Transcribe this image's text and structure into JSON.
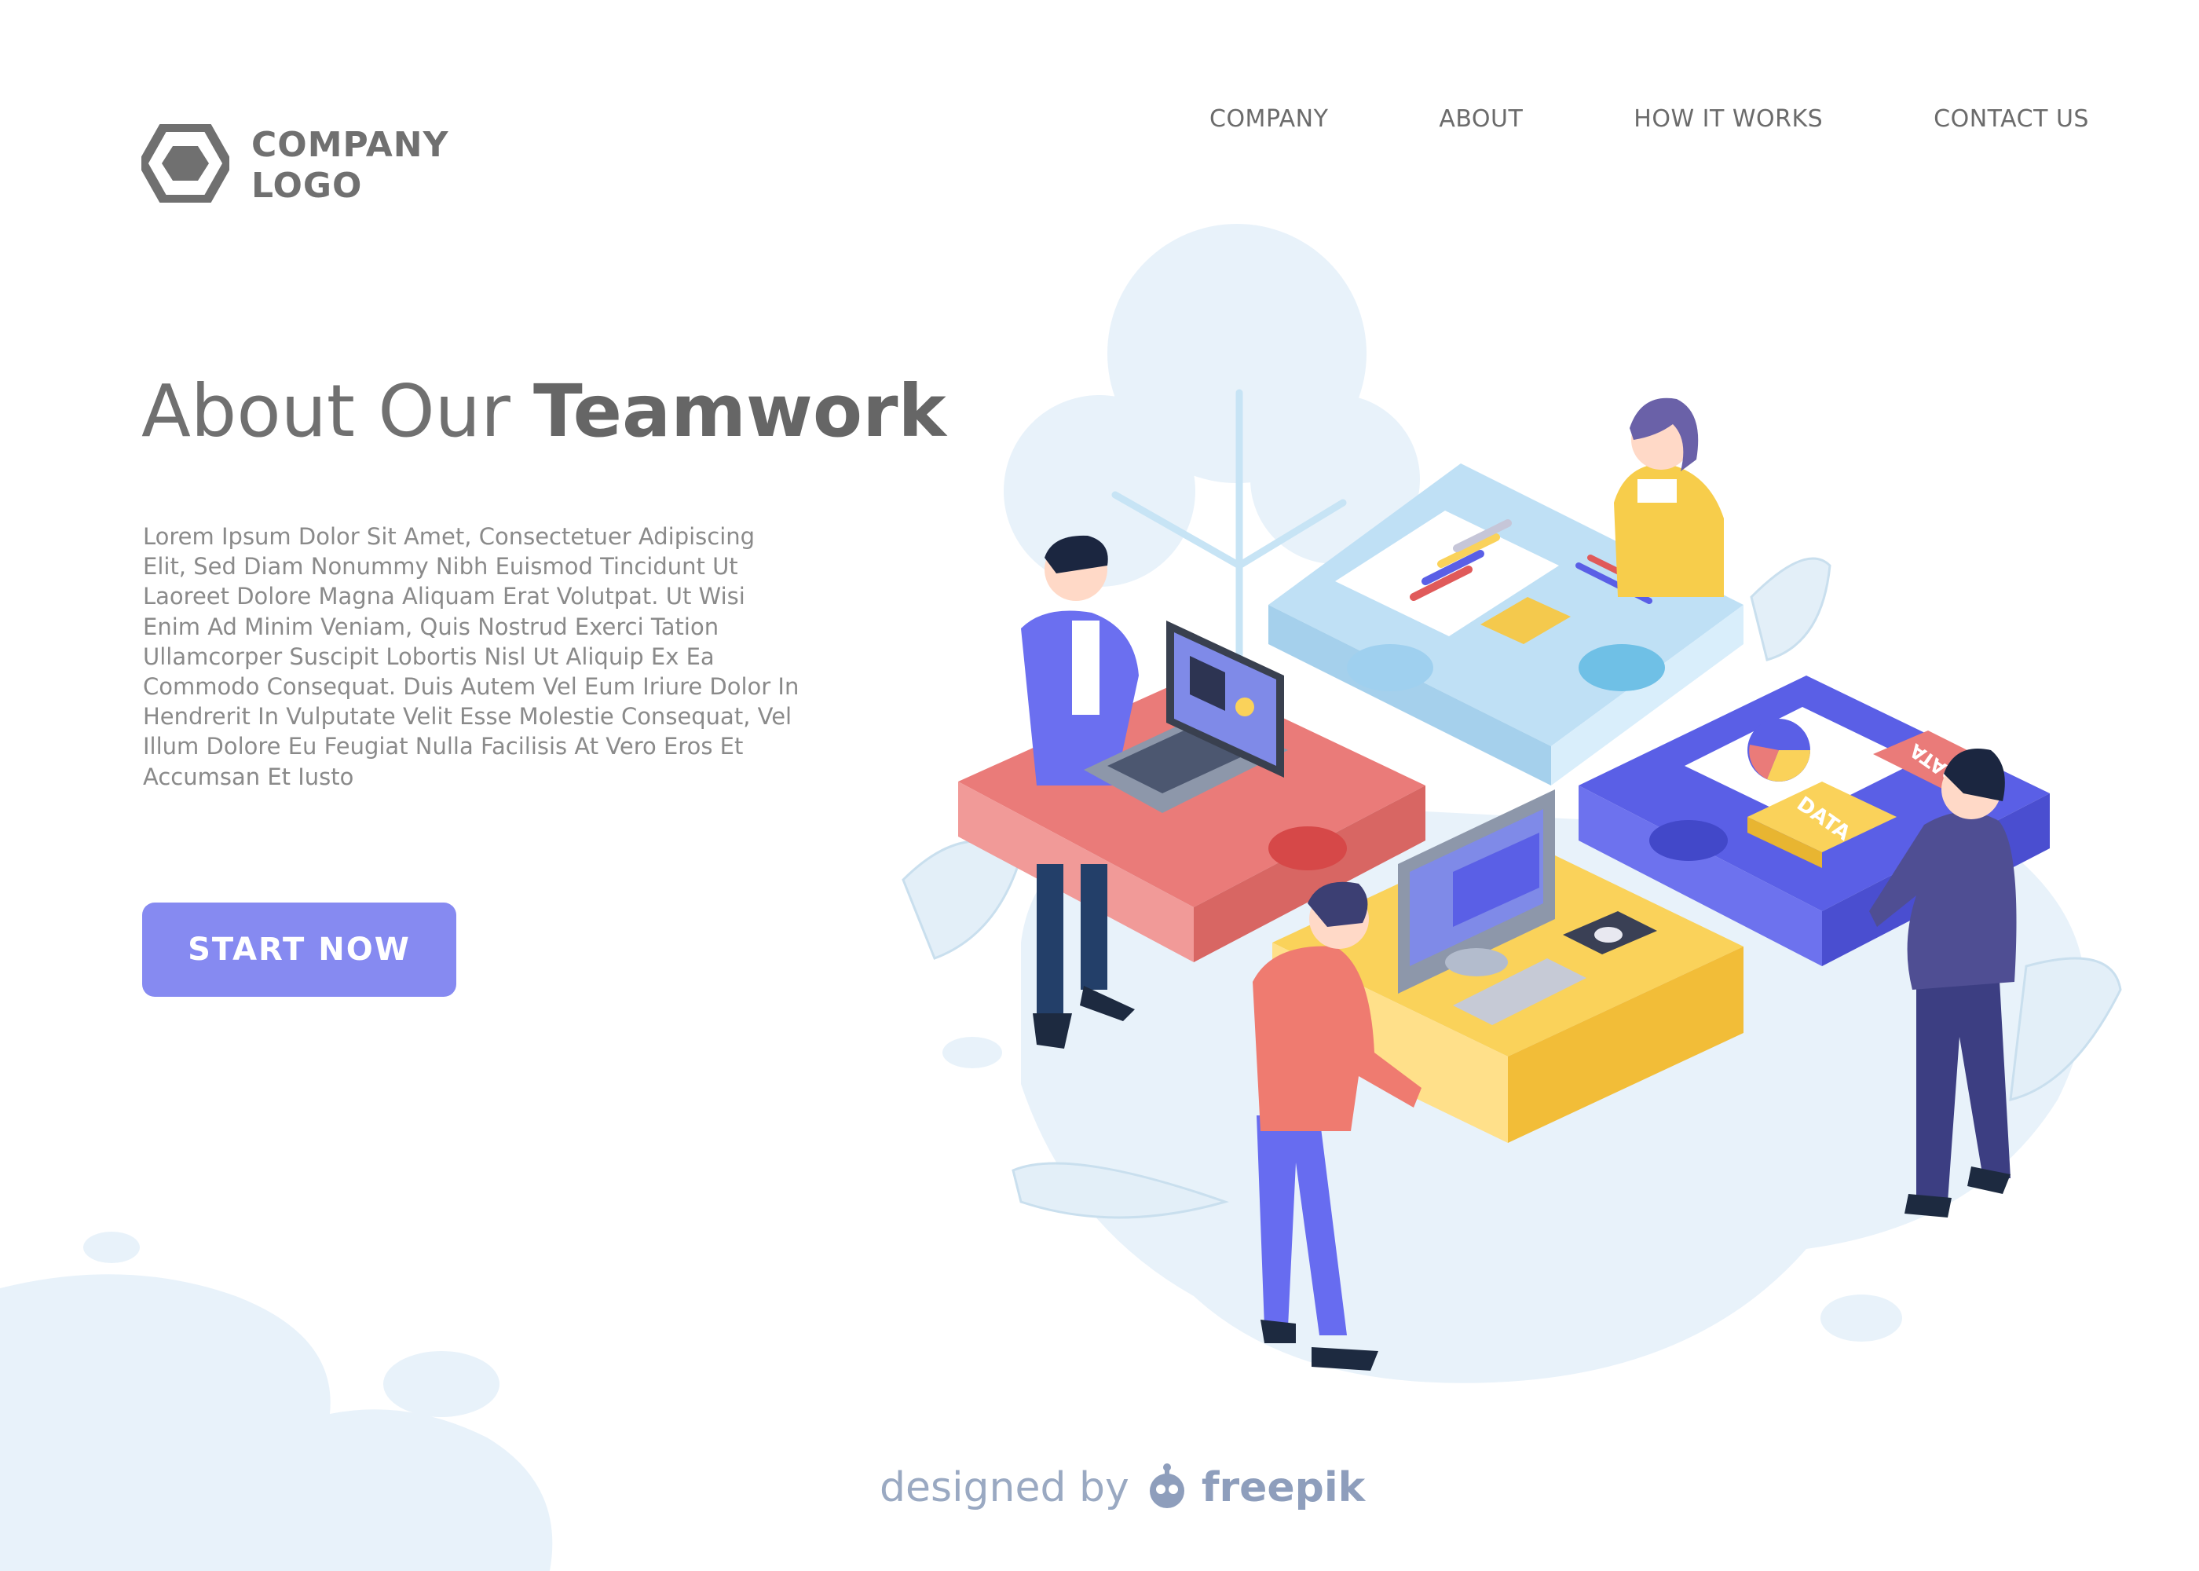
{
  "logo": {
    "line1": "COMPANY",
    "line2": "LOGO",
    "icon": "hexagon-icon"
  },
  "nav": {
    "items": [
      "COMPANY",
      "ABOUT",
      "HOW IT WORKS",
      "CONTACT US"
    ]
  },
  "hero": {
    "title_light": "About Our",
    "title_bold": "Teamwork",
    "body_lines": [
      "Lorem Ipsum Dolor Sit Amet, Consectetuer Adipiscing",
      "Elit, Sed Diam Nonummy Nibh Euismod Tincidunt Ut",
      "Laoreet Dolore Magna Aliquam Erat Volutpat. Ut Wisi",
      "Enim Ad Minim Veniam, Quis Nostrud Exerci Tation",
      "Ullamcorper Suscipit Lobortis Nisl Ut Aliquip Ex Ea",
      "Commodo Consequat. Duis Autem Vel Eum Iriure Dolor In",
      "Hendrerit In Vulputate Velit Esse Molestie Consequat, Vel",
      "Illum Dolore Eu Feugiat Nulla Facilisis At Vero Eros Et",
      "Accumsan Et Iusto"
    ],
    "cta_label": "START NOW"
  },
  "illustration": {
    "tiles": [
      "DATA",
      "DATA"
    ]
  },
  "credit": {
    "prefix": "designed by",
    "brand": "freepik",
    "icon": "freepik-robot-icon"
  },
  "colors": {
    "accent": "#868af1",
    "text": "#707070",
    "blob": "#e8f2fa",
    "red": "#ea7b79",
    "yellow": "#fad25a",
    "blue": "#5a5fe6",
    "lightblue": "#bfe0f5"
  }
}
